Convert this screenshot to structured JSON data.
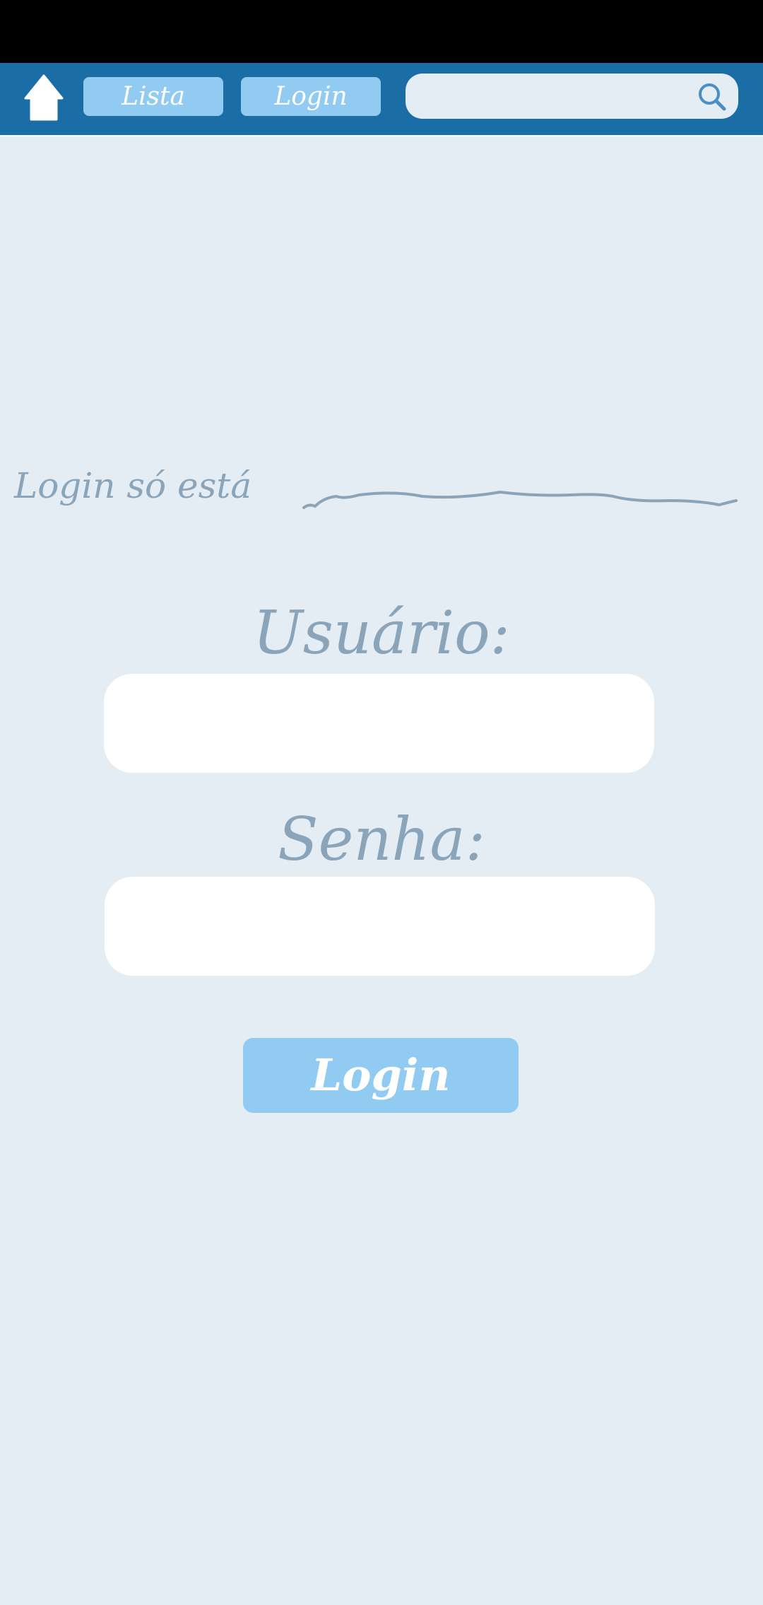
{
  "navbar": {
    "home_icon": "home-icon",
    "buttons": [
      {
        "label": "Lista"
      },
      {
        "label": "Login"
      }
    ],
    "search": {
      "value": "",
      "placeholder": "",
      "icon": "search-icon"
    }
  },
  "main": {
    "notice_text": "Login só está",
    "user_label": "Usuário:",
    "password_label": "Senha:",
    "user_value": "",
    "password_value": "",
    "submit_label": "Login"
  },
  "colors": {
    "navbar": "#1a6da5",
    "button": "#91cbf1",
    "background": "#e5edf4",
    "label_text": "#8aa4b9",
    "status_bar": "#000000"
  }
}
